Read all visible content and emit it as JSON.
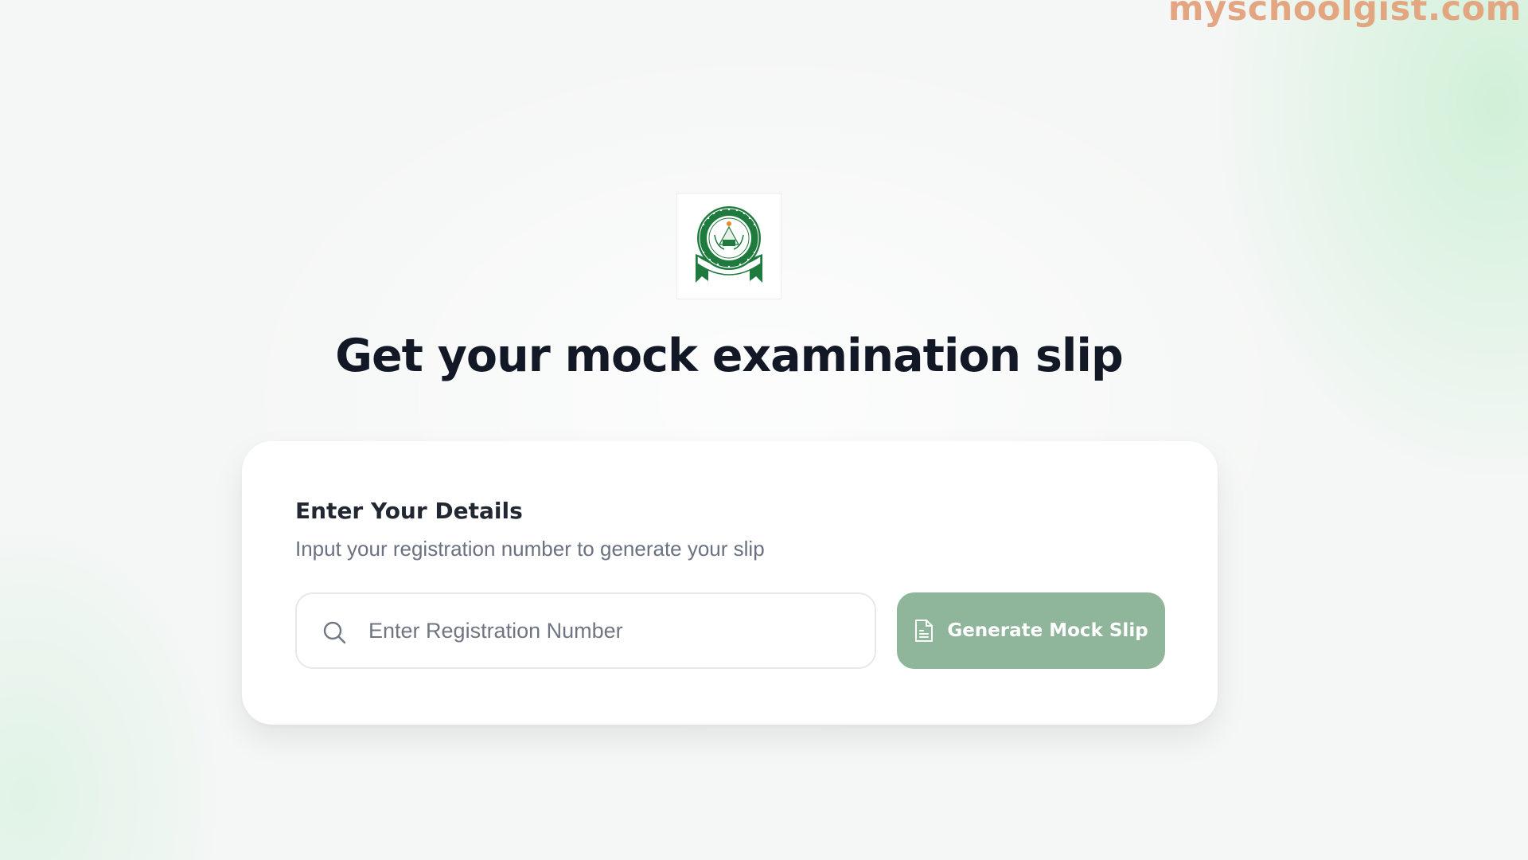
{
  "watermark": {
    "text": "myschoolgist.com",
    "color": "#e39e76"
  },
  "logo": {
    "icon": "jamb-seal-logo-icon"
  },
  "page": {
    "title": "Get your mock examination slip"
  },
  "form": {
    "heading": "Enter Your Details",
    "description": "Input your registration number to generate your slip",
    "search_icon": "search-icon",
    "input_placeholder": "Enter Registration Number",
    "input_value": "",
    "button_icon": "document-icon",
    "button_label": "Generate Mock Slip",
    "button_color": "#8fb59a"
  },
  "colors": {
    "title": "#121826",
    "brand_green": "#1f7a3e",
    "background_accent": "#c4eece"
  }
}
